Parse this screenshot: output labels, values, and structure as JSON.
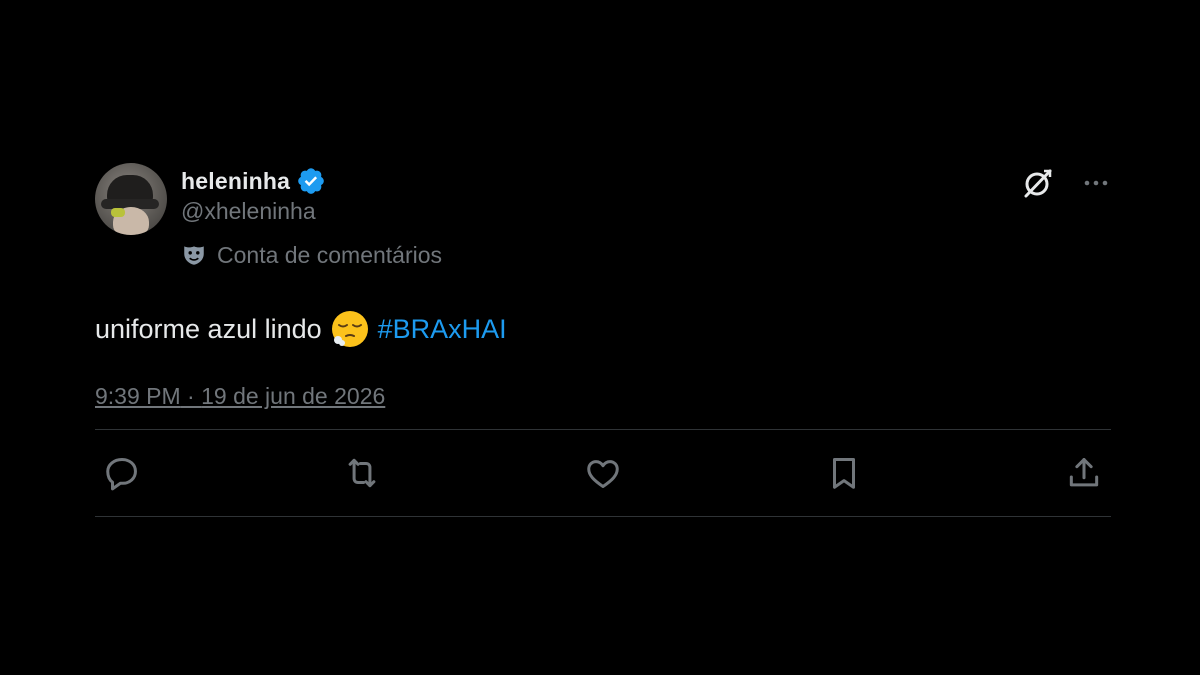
{
  "post": {
    "author": {
      "display_name": "heleninha",
      "handle": "@xheleninha",
      "verified": true,
      "verified_color": "#1d9bf0",
      "label_icon": "mask-icon",
      "label_text": "Conta de comentários"
    },
    "text": {
      "before_emoji": "uniforme azul lindo",
      "emoji": "relieved-face-exhaling",
      "hashtag": "#BRAxHAI"
    },
    "timestamp": {
      "time": "9:39 PM",
      "separator": " · ",
      "date": "19 de jun de 2026"
    },
    "top_actions": [
      "grok-icon",
      "more-icon"
    ],
    "actions": [
      "reply-icon",
      "repost-icon",
      "like-icon",
      "bookmark-icon",
      "share-icon"
    ]
  },
  "colors": {
    "background": "#000000",
    "text_primary": "#e7e9ea",
    "text_secondary": "#71767b",
    "accent": "#1d9bf0",
    "divider": "#2f3336"
  }
}
